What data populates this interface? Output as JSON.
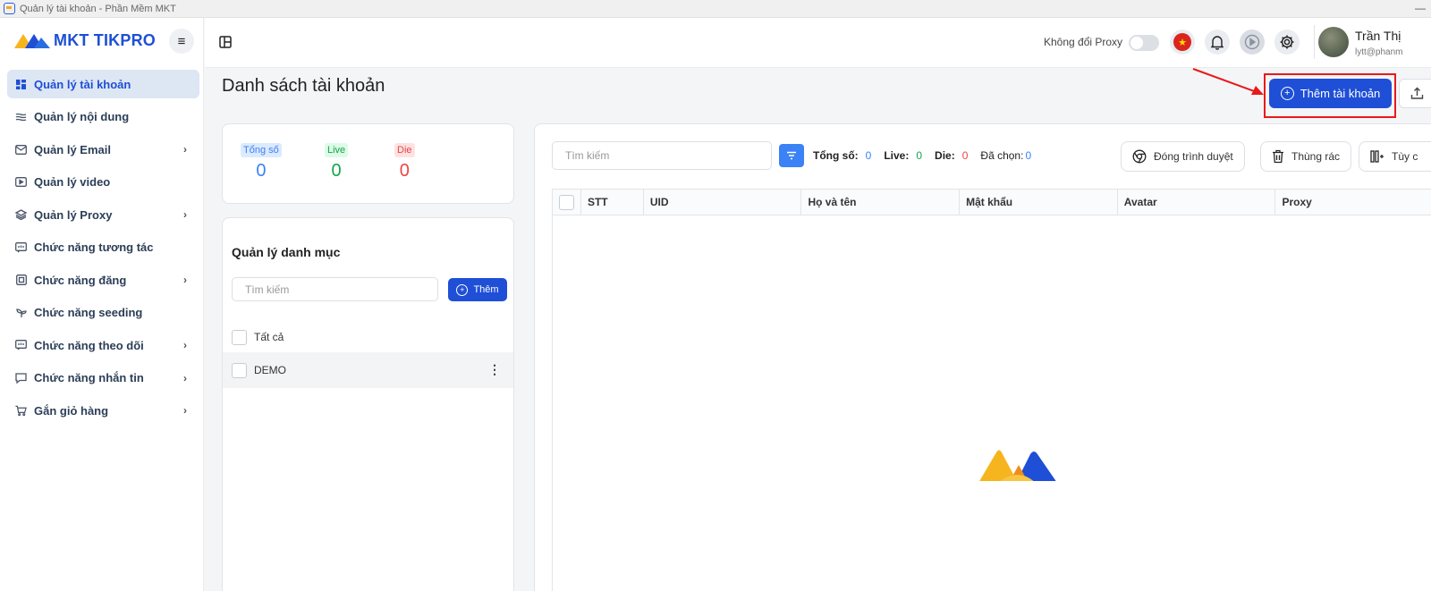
{
  "window": {
    "title": "Quản lý tài khoản - Phần Mềm MKT",
    "minimize": "—"
  },
  "brand": {
    "name": "MKT TIKPRO"
  },
  "menu_toggle_glyph": "≡",
  "sidebar": {
    "items": [
      {
        "label": "Quản lý tài khoản",
        "icon": "dashboard-icon",
        "active": true,
        "has_chevron": false
      },
      {
        "label": "Quản lý nội dung",
        "icon": "content-icon",
        "active": false,
        "has_chevron": false
      },
      {
        "label": "Quản lý Email",
        "icon": "mail-icon",
        "active": false,
        "has_chevron": true
      },
      {
        "label": "Quản lý video",
        "icon": "video-icon",
        "active": false,
        "has_chevron": false
      },
      {
        "label": "Quản lý Proxy",
        "icon": "layers-icon",
        "active": false,
        "has_chevron": true
      },
      {
        "label": "Chức năng tương tác",
        "icon": "interact-icon",
        "active": false,
        "has_chevron": false
      },
      {
        "label": "Chức năng đăng",
        "icon": "post-icon",
        "active": false,
        "has_chevron": true
      },
      {
        "label": "Chức năng seeding",
        "icon": "sprout-icon",
        "active": false,
        "has_chevron": false
      },
      {
        "label": "Chức năng theo dõi",
        "icon": "follow-icon",
        "active": false,
        "has_chevron": true
      },
      {
        "label": "Chức năng nhắn tin",
        "icon": "message-icon",
        "active": false,
        "has_chevron": true
      },
      {
        "label": "Gắn giỏ hàng",
        "icon": "cart-icon",
        "active": false,
        "has_chevron": true
      }
    ]
  },
  "topbar": {
    "proxy_label": "Không đổi Proxy",
    "proxy_toggle_on": false,
    "flag_glyph": "★",
    "user_name": "Trần Thị",
    "user_email": "lytt@phanm"
  },
  "page": {
    "title": "Danh sách tài khoản",
    "add_account_label": "Thêm tài khoản",
    "plus_glyph": "+"
  },
  "stats": {
    "total": {
      "label": "Tổng số",
      "value": "0"
    },
    "live": {
      "label": "Live",
      "value": "0"
    },
    "die": {
      "label": "Die",
      "value": "0"
    }
  },
  "categories": {
    "title": "Quản lý danh mục",
    "search_placeholder": "Tìm kiếm",
    "add_label": "Thêm",
    "all_label": "Tất cả",
    "items": [
      {
        "label": "DEMO"
      }
    ],
    "kebab_glyph": "⋮"
  },
  "table": {
    "search_placeholder": "Tìm kiếm",
    "counts": {
      "total_label": "Tổng số:",
      "total": "0",
      "live_label": "Live:",
      "live": "0",
      "die_label": "Die:",
      "die": "0",
      "selected_label": "Đã chọn:",
      "selected": "0"
    },
    "buttons": {
      "close_browser": "Đóng trình duyệt",
      "trash": "Thùng rác",
      "customize": "Tùy c"
    },
    "columns": [
      "STT",
      "UID",
      "Họ và tên",
      "Mật khẩu",
      "Avatar",
      "Proxy"
    ],
    "rows": []
  },
  "colors": {
    "primary": "#1e4fd6",
    "total_blue": "#3b82f6",
    "live_green": "#16a34a",
    "die_red": "#ef4444",
    "highlight_red": "#e81a1a"
  }
}
